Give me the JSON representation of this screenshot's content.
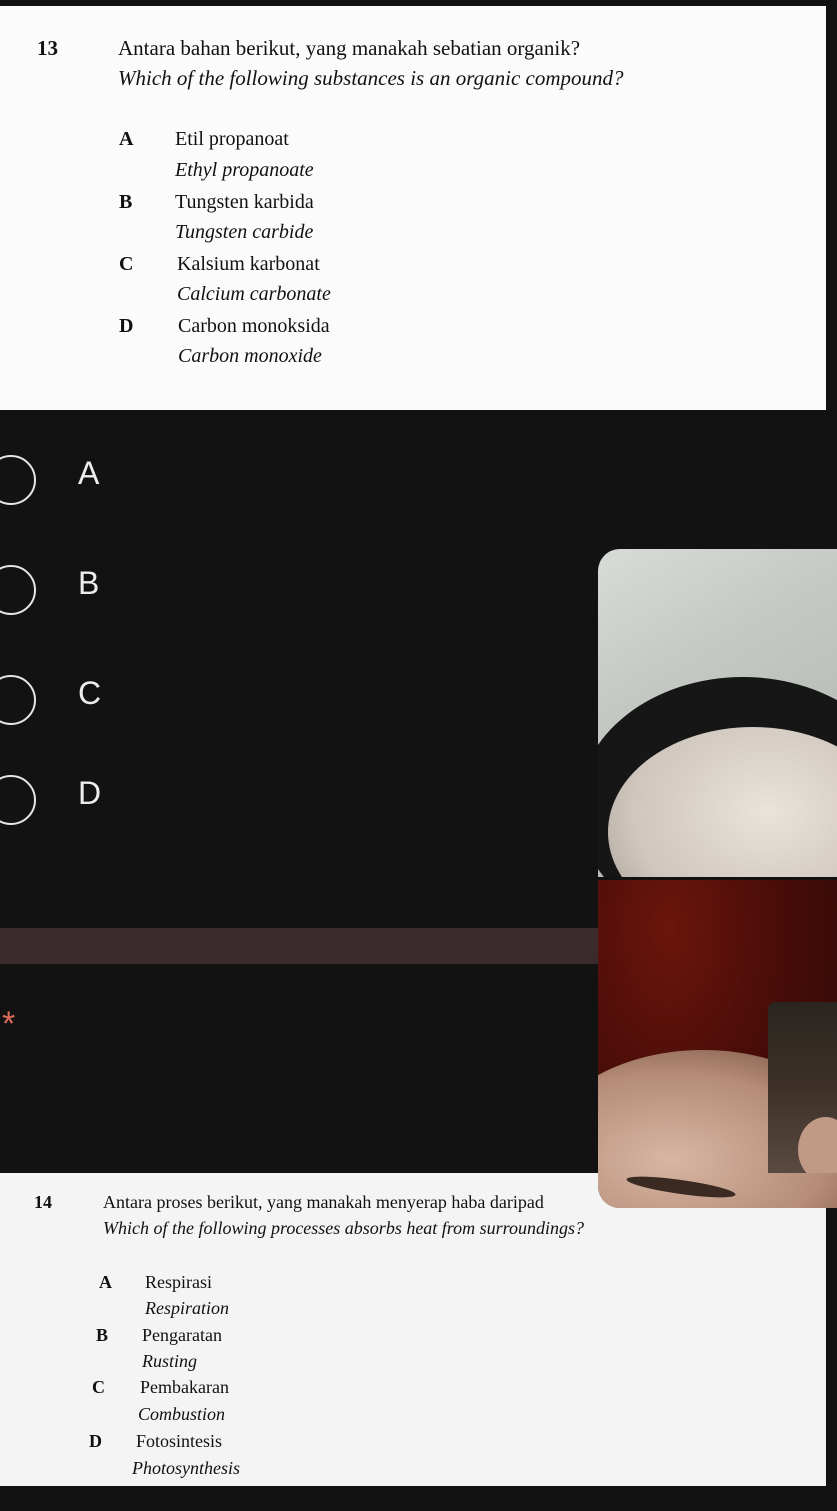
{
  "question13": {
    "number": "13",
    "text_ms": "Antara bahan berikut, yang manakah sebatian organik?",
    "text_en": "Which of the following substances is an organic compound?",
    "options": [
      {
        "letter": "A",
        "ms": "Etil propanoat",
        "en": "Ethyl propanoate"
      },
      {
        "letter": "B",
        "ms": "Tungsten karbida",
        "en": "Tungsten carbide"
      },
      {
        "letter": "C",
        "ms": "Kalsium karbonat",
        "en": "Calcium carbonate"
      },
      {
        "letter": "D",
        "ms": "Carbon monoksida",
        "en": "Carbon monoxide"
      }
    ]
  },
  "answer_choices": [
    "A",
    "B",
    "C",
    "D"
  ],
  "required_marker": "*",
  "question14": {
    "number": "14",
    "text_ms": "Antara proses berikut, yang manakah menyerap haba daripad",
    "text_en": "Which of the following processes absorbs heat from surroundings?",
    "options": [
      {
        "letter": "A",
        "ms": "Respirasi",
        "en": "Respiration"
      },
      {
        "letter": "B",
        "ms": "Pengaratan",
        "en": "Rusting"
      },
      {
        "letter": "C",
        "ms": "Pembakaran",
        "en": "Combustion"
      },
      {
        "letter": "D",
        "ms": "Fotosintesis",
        "en": "Photosynthesis"
      }
    ]
  },
  "colors": {
    "background": "#121213",
    "paper": "#fbfbfb",
    "divider": "#3b2b2c",
    "required": "#e06b5a"
  }
}
